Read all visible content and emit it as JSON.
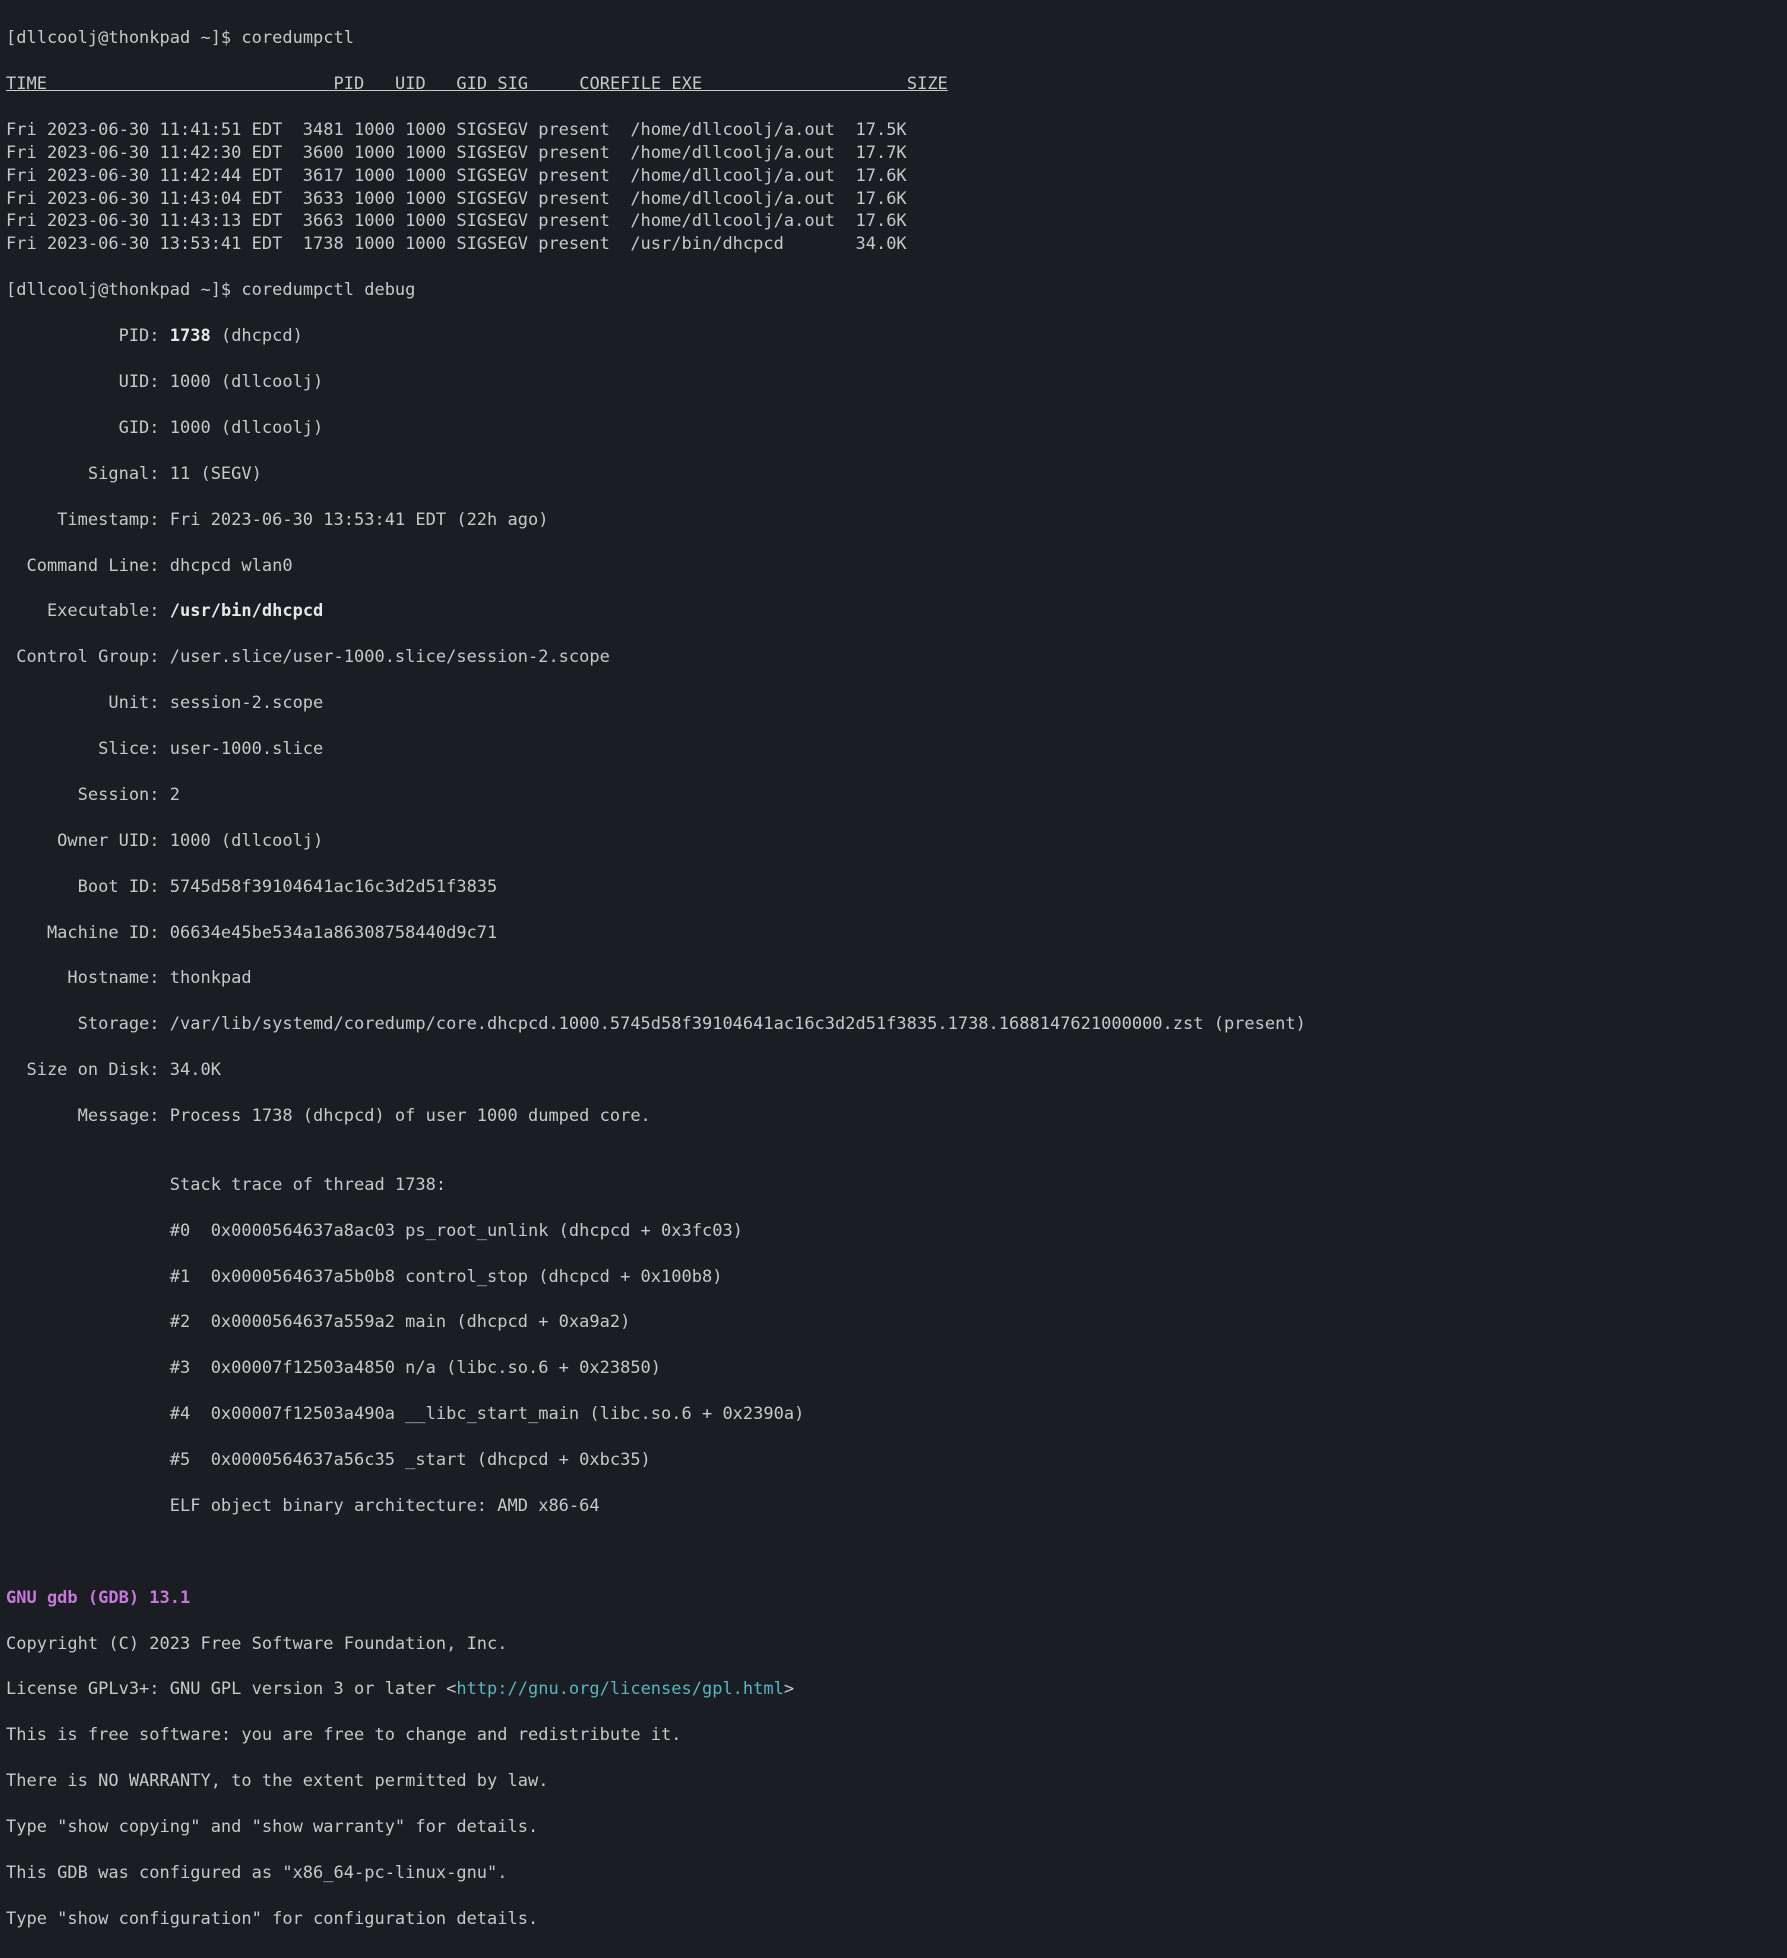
{
  "prompt1": "[dllcoolj@thonkpad ~]$ ",
  "cmd1": "coredumpctl",
  "header": {
    "time": "TIME",
    "pid": "PID",
    "uid": "UID",
    "gid": "GID",
    "sig": "SIG",
    "corefile": "COREFILE",
    "exe": "EXE",
    "size": "SIZE"
  },
  "rows": [
    {
      "time": "Fri 2023-06-30 11:41:51 EDT",
      "pid": "3481",
      "uid": "1000",
      "gid": "1000",
      "sig": "SIGSEGV",
      "corefile": "present",
      "exe": "/home/dllcoolj/a.out",
      "size": "17.5K"
    },
    {
      "time": "Fri 2023-06-30 11:42:30 EDT",
      "pid": "3600",
      "uid": "1000",
      "gid": "1000",
      "sig": "SIGSEGV",
      "corefile": "present",
      "exe": "/home/dllcoolj/a.out",
      "size": "17.7K"
    },
    {
      "time": "Fri 2023-06-30 11:42:44 EDT",
      "pid": "3617",
      "uid": "1000",
      "gid": "1000",
      "sig": "SIGSEGV",
      "corefile": "present",
      "exe": "/home/dllcoolj/a.out",
      "size": "17.6K"
    },
    {
      "time": "Fri 2023-06-30 11:43:04 EDT",
      "pid": "3633",
      "uid": "1000",
      "gid": "1000",
      "sig": "SIGSEGV",
      "corefile": "present",
      "exe": "/home/dllcoolj/a.out",
      "size": "17.6K"
    },
    {
      "time": "Fri 2023-06-30 11:43:13 EDT",
      "pid": "3663",
      "uid": "1000",
      "gid": "1000",
      "sig": "SIGSEGV",
      "corefile": "present",
      "exe": "/home/dllcoolj/a.out",
      "size": "17.6K"
    },
    {
      "time": "Fri 2023-06-30 13:53:41 EDT",
      "pid": "1738",
      "uid": "1000",
      "gid": "1000",
      "sig": "SIGSEGV",
      "corefile": "present",
      "exe": "/usr/bin/dhcpcd",
      "size": "34.0K"
    }
  ],
  "prompt2": "[dllcoolj@thonkpad ~]$ ",
  "cmd2": "coredumpctl debug",
  "info": {
    "pid_label": "           PID: ",
    "pid_value": "1738",
    "pid_extra": " (dhcpcd)",
    "uid": "           UID: 1000 (dllcoolj)",
    "gid": "           GID: 1000 (dllcoolj)",
    "signal": "        Signal: 11 (SEGV)",
    "timestamp": "     Timestamp: Fri 2023-06-30 13:53:41 EDT (22h ago)",
    "cmdline": "  Command Line: dhcpcd wlan0",
    "exe_label": "    Executable: ",
    "exe_value": "/usr/bin/dhcpcd",
    "cgroup": " Control Group: /user.slice/user-1000.slice/session-2.scope",
    "unit": "          Unit: session-2.scope",
    "slice": "         Slice: user-1000.slice",
    "session": "       Session: 2",
    "owner_uid": "     Owner UID: 1000 (dllcoolj)",
    "boot_id": "       Boot ID: 5745d58f39104641ac16c3d2d51f3835",
    "machine_id": "    Machine ID: 06634e45be534a1a86308758440d9c71",
    "hostname": "      Hostname: thonkpad",
    "storage": "       Storage: /var/lib/systemd/coredump/core.dhcpcd.1000.5745d58f39104641ac16c3d2d51f3835.1738.1688147621000000.zst (present)",
    "size_on_disk": "  Size on Disk: 34.0K",
    "message": "       Message: Process 1738 (dhcpcd) of user 1000 dumped core.",
    "blank1": "",
    "stack_hdr": "                Stack trace of thread 1738:",
    "st0": "                #0  0x0000564637a8ac03 ps_root_unlink (dhcpcd + 0x3fc03)",
    "st1": "                #1  0x0000564637a5b0b8 control_stop (dhcpcd + 0x100b8)",
    "st2": "                #2  0x0000564637a559a2 main (dhcpcd + 0xa9a2)",
    "st3": "                #3  0x00007f12503a4850 n/a (libc.so.6 + 0x23850)",
    "st4": "                #4  0x00007f12503a490a __libc_start_main (libc.so.6 + 0x2390a)",
    "st5": "                #5  0x0000564637a56c35 _start (dhcpcd + 0xbc35)",
    "elf": "                ELF object binary architecture: AMD x86-64"
  },
  "gdb": {
    "header": "GNU gdb (GDB) 13.1",
    "copyright": "Copyright (C) 2023 Free Software Foundation, Inc.",
    "license_pre": "License GPLv3+: GNU GPL version 3 or later <",
    "license_url": "http://gnu.org/licenses/gpl.html",
    "license_post": ">",
    "free": "This is free software: you are free to change and redistribute it.",
    "warranty": "There is NO WARRANTY, to the extent permitted by law.",
    "show1": "Type \"show copying\" and \"show warranty\" for details.",
    "configured": "This GDB was configured as \"x86_64-pc-linux-gnu\".",
    "show2": "Type \"show configuration\" for configuration details."
  }
}
